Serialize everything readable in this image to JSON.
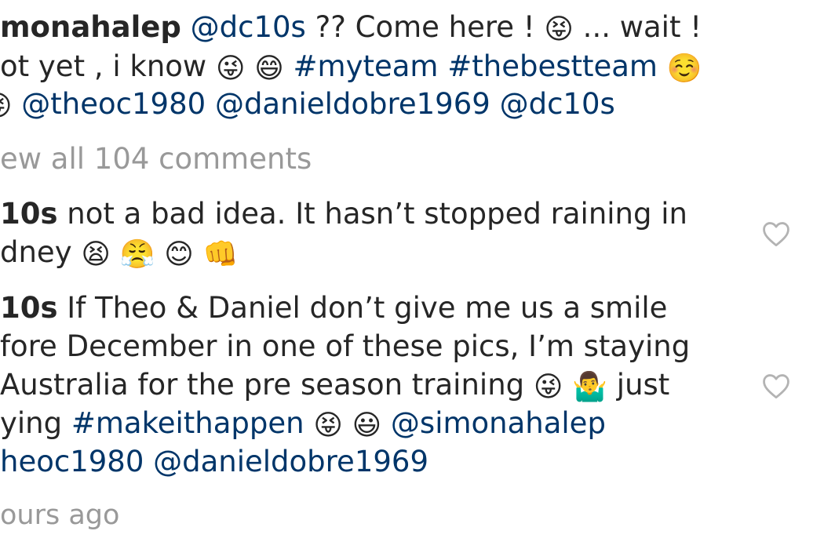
{
  "caption": {
    "author": "monahalep",
    "mention_1": "@dc10s",
    "text_1": " ?? Come here ! ",
    "emoji_1": "😝",
    "text_2": " ... wait !",
    "line2_prefix": "ot yet , i know ",
    "emoji_2": "😜",
    "emoji_3": "😄",
    "hashtag_1": "#myteam",
    "hashtag_2": "#thebestteam",
    "emoji_4": "☺️",
    "line3_emoji": "😜",
    "mention_2": "@theoc1980",
    "mention_3": "@danieldobre1969",
    "mention_4": "@dc10s"
  },
  "view_all": "ew all 104 comments",
  "comments": [
    {
      "author": "10s",
      "line1": " not a bad idea. It hasn’t stopped raining in",
      "line2_prefix": "dney ",
      "emoji_1": "😫",
      "emoji_2": "😤",
      "emoji_3": "😊",
      "emoji_4": "👊"
    },
    {
      "author": "10s",
      "line1": " If Theo & Daniel don’t give me us a smile",
      "line2": "fore December in one of these pics, I’m staying",
      "line3_prefix": "Australia for the pre season training ",
      "emoji_1": "😜",
      "emoji_2": "🤷‍♂️",
      "line3_suffix": " just",
      "line4_prefix": "ying ",
      "hashtag": "#makeithappen",
      "emoji_3": "😝",
      "emoji_4": "😃",
      "mention_1": "@simonahalep",
      "line5": "heoc1980 @danieldobre1969"
    }
  ],
  "timestamp": "ours ago",
  "icons": {
    "like": "heart-outline-icon"
  }
}
